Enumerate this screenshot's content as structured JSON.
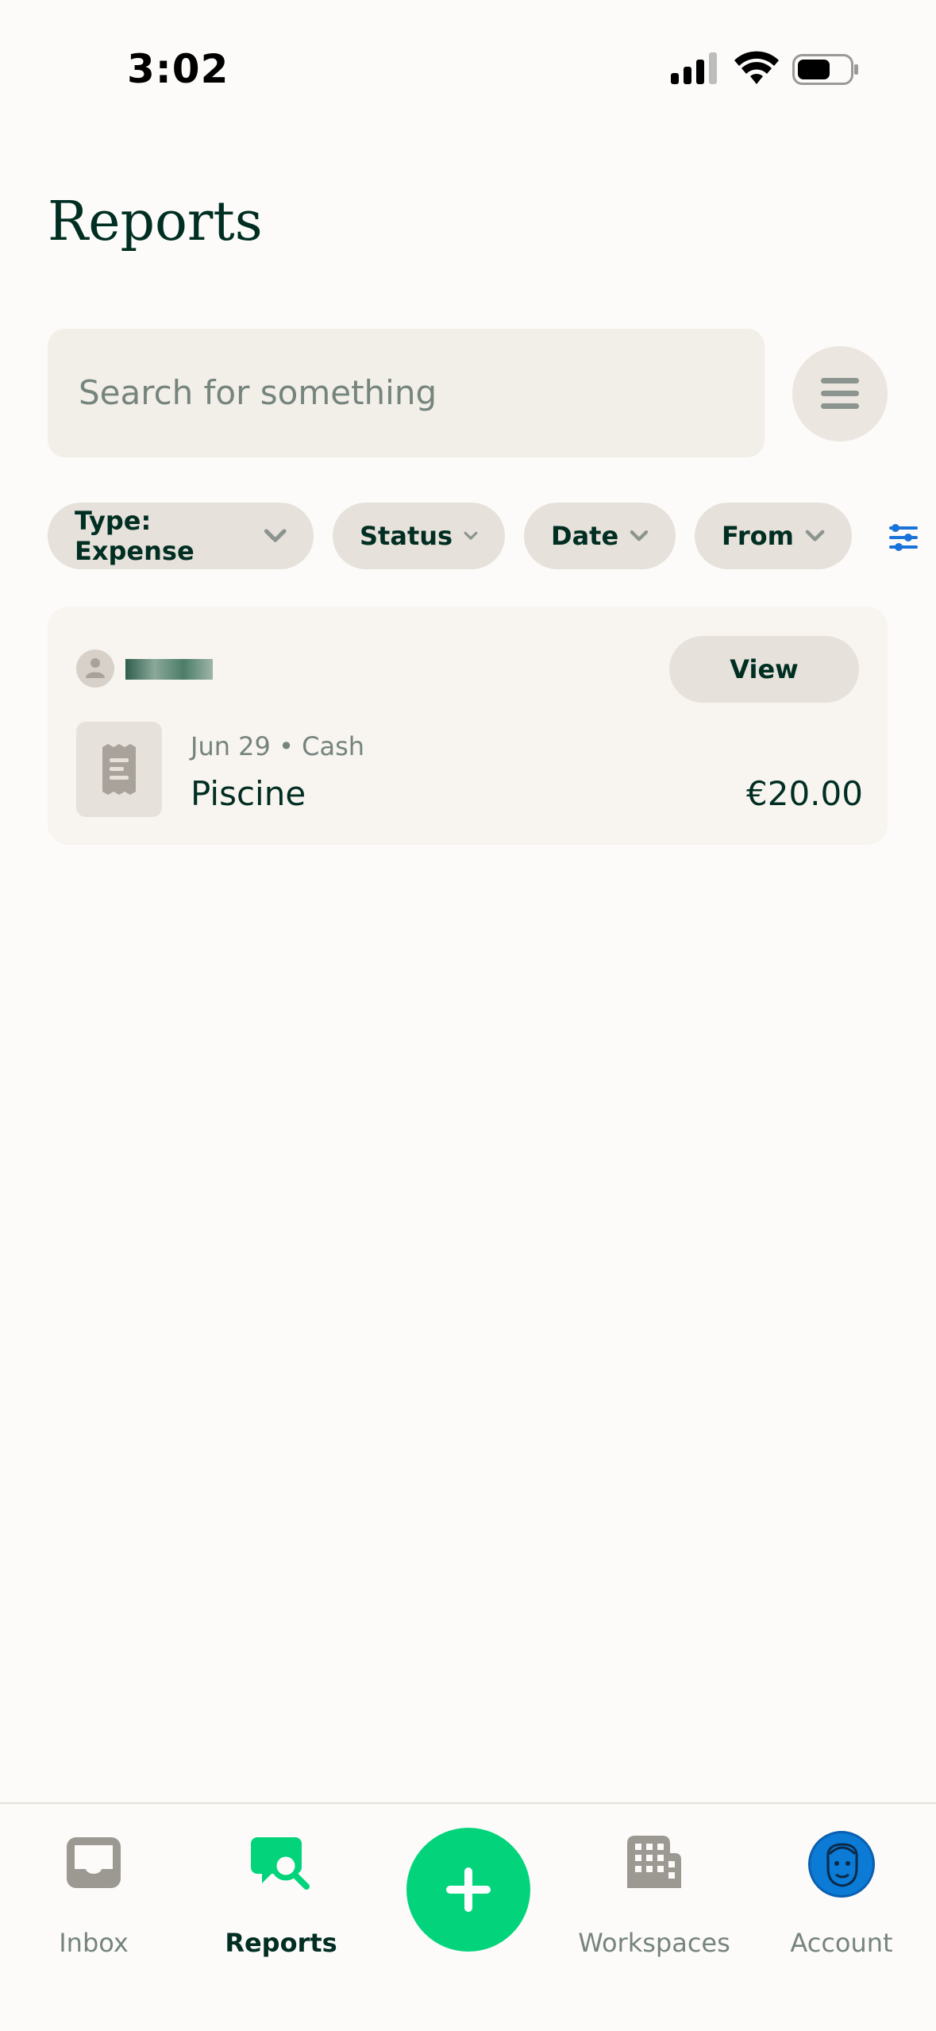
{
  "status_bar": {
    "time": "3:02"
  },
  "header": {
    "title": "Reports"
  },
  "search": {
    "placeholder": "Search for something"
  },
  "filters": [
    {
      "label": "Type: Expense"
    },
    {
      "label": "Status"
    },
    {
      "label": "Date"
    },
    {
      "label": "From"
    }
  ],
  "expense": {
    "meta": "Jun 29 • Cash",
    "merchant": "Piscine",
    "amount": "€20.00",
    "view_label": "View"
  },
  "nav": {
    "inbox": "Inbox",
    "reports": "Reports",
    "workspaces": "Workspaces",
    "account": "Account"
  },
  "colors": {
    "accent_green": "#03d47c",
    "text_dark": "#002e22",
    "muted": "#76847e",
    "filter_icon_blue": "#1a73d9"
  }
}
